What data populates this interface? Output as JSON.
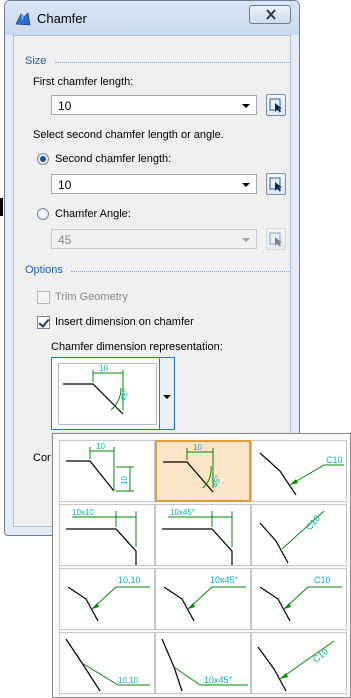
{
  "window": {
    "title": "Chamfer"
  },
  "size": {
    "section_label": "Size",
    "first_length_label": "First chamfer length:",
    "first_length_value": "10",
    "select_second_label": "Select second chamfer length or angle.",
    "second_length_label": "Second chamfer length:",
    "second_length_value": "10",
    "angle_label": "Chamfer Angle:",
    "angle_value": "45"
  },
  "options": {
    "section_label": "Options",
    "trim_label": "Trim Geometry",
    "insert_dim_label": "Insert dimension on chamfer",
    "representation_label": "Chamfer dimension representation:",
    "bottom_clipped_label": "Cor"
  },
  "preview": {
    "len": "10",
    "angle": "45°"
  },
  "gallery": {
    "highlight_color": "#e59b3c",
    "dimension_color": "#00b4b4",
    "cells": [
      {
        "a": "10",
        "b": "10"
      },
      {
        "a": "10",
        "b": "45°"
      },
      {
        "a": "C10"
      },
      {
        "a": "10x10"
      },
      {
        "a": "10x45°"
      },
      {
        "a": "C10"
      },
      {
        "a": "10,10"
      },
      {
        "a": "10x45°"
      },
      {
        "a": "C10"
      },
      {
        "a": "10,10"
      },
      {
        "a": "10x45°"
      },
      {
        "a": "C10"
      }
    ]
  }
}
